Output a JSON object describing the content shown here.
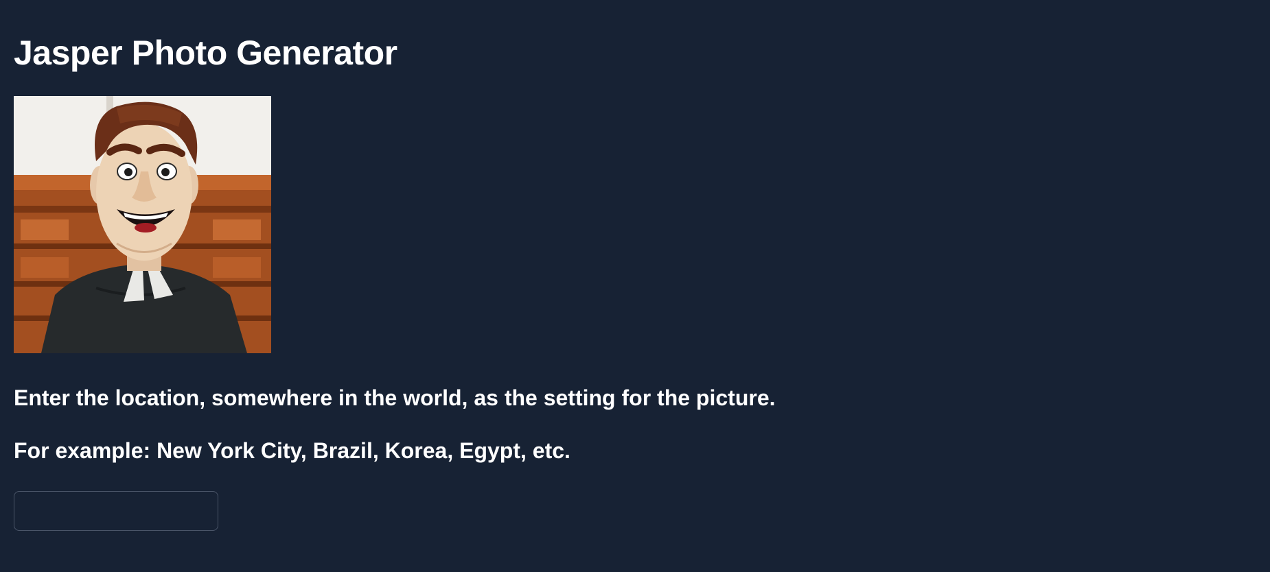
{
  "page": {
    "title": "Jasper Photo Generator"
  },
  "photo": {
    "alt": "Jasper mascot",
    "icon": "mascot-photo"
  },
  "instructions": {
    "line1": "Enter the location, somewhere in the world, as the setting for the picture.",
    "line2": "For example: New York City, Brazil, Korea, Egypt, etc."
  },
  "location_input": {
    "value": "",
    "placeholder": ""
  },
  "colors": {
    "background": "#172234",
    "text": "#ffffff",
    "input_border": "#4a5568"
  }
}
